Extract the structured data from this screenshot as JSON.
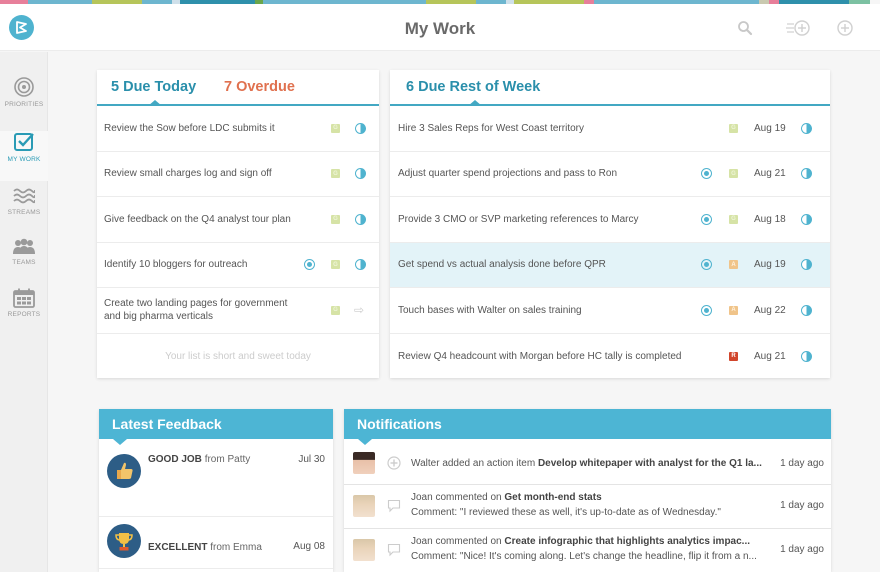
{
  "app": {
    "title": "My Work",
    "brand_color": "#4fb3cf",
    "stripe_colors": [
      "#e77f9a",
      "#6db6cf",
      "#b6c55a",
      "#6db6cf",
      "#cfe0ea",
      "#2e90ab",
      "#6aa64b",
      "#6db6cf",
      "#b6c55a",
      "#6db6cf",
      "#cfe0ea",
      "#b6c55a",
      "#e77f9a",
      "#6db6cf",
      "#c9c9b0",
      "#e77f9a",
      "#2e90ab",
      "#7cc1a2"
    ]
  },
  "header": {
    "title": "My Work",
    "icons": [
      "search-icon",
      "quick-add-icon",
      "add-icon"
    ]
  },
  "sidebar": {
    "items": [
      {
        "label": "PRIORITIES",
        "icon": "target-icon",
        "active": false
      },
      {
        "label": "MY WORK",
        "icon": "checkbox-icon",
        "active": true
      },
      {
        "label": "STREAMS",
        "icon": "waves-icon",
        "active": false
      },
      {
        "label": "TEAMS",
        "icon": "people-icon",
        "active": false
      },
      {
        "label": "REPORTS",
        "icon": "calendar-icon",
        "active": false
      }
    ]
  },
  "today_card": {
    "tabs": [
      {
        "label": "5 Due Today",
        "color": "#2a8fab",
        "active": true
      },
      {
        "label": "7 Overdue",
        "color": "#e0714f",
        "active": false
      }
    ],
    "tasks": [
      {
        "text": "Review the Sow before LDC submits it",
        "priority": false,
        "tag": "G",
        "status": "half-circle"
      },
      {
        "text": "Review small charges log and sign off",
        "priority": false,
        "tag": "G",
        "status": "half-circle"
      },
      {
        "text": "Give feedback on the Q4 analyst tour plan",
        "priority": false,
        "tag": "G",
        "status": "half-circle"
      },
      {
        "text": "Identify 10 bloggers for outreach",
        "priority": true,
        "tag": "G",
        "status": "half-circle"
      },
      {
        "text": "Create two landing pages for government and big pharma verticals",
        "priority": false,
        "tag": "G",
        "status": "arrow"
      }
    ],
    "empty_message": "Your list is short and sweet today"
  },
  "week_card": {
    "tabs": [
      {
        "label": "6 Due Rest of Week",
        "color": "#2a8fab",
        "active": true
      }
    ],
    "tasks": [
      {
        "text": "Hire 3 Sales Reps for West Coast territory",
        "priority": false,
        "tag": "G",
        "date": "Aug 19",
        "highlight": false
      },
      {
        "text": "Adjust quarter spend projections and pass to Ron",
        "priority": true,
        "tag": "G",
        "date": "Aug 21",
        "highlight": false
      },
      {
        "text": "Provide 3 CMO or SVP marketing references to Marcy",
        "priority": true,
        "tag": "G",
        "date": "Aug 18",
        "highlight": false
      },
      {
        "text": "Get spend vs actual analysis done before QPR",
        "priority": true,
        "tag": "A",
        "date": "Aug 19",
        "highlight": true
      },
      {
        "text": "Touch bases with Walter on sales training",
        "priority": true,
        "tag": "A",
        "date": "Aug 22",
        "highlight": false
      },
      {
        "text": "Review Q4 headcount with Morgan before HC tally is completed",
        "priority": false,
        "tag": "R",
        "date": "Aug 21",
        "highlight": false
      }
    ]
  },
  "feedback": {
    "title": "Latest Feedback",
    "items": [
      {
        "badge": "GOOD JOB",
        "from_word": "from",
        "from": "Patty",
        "date": "Jul 30",
        "icon": "thumbs-up-icon"
      },
      {
        "badge": "EXCELLENT",
        "from_word": "from",
        "from": "Emma",
        "date": "Aug 08",
        "icon": "trophy-icon"
      }
    ]
  },
  "notifications": {
    "title": "Notifications",
    "items": [
      {
        "actor": "Walter",
        "action": "added an action item",
        "subject": "Develop whitepaper with analyst for the Q1 la...",
        "comment": "",
        "time": "1 day ago",
        "icon": "add-circle-icon"
      },
      {
        "actor": "Joan",
        "action": "commented on",
        "subject": "Get month-end stats",
        "comment": "Comment: \"I reviewed these as well, it's up-to-date as of Wednesday.\"",
        "time": "1 day ago",
        "icon": "comment-icon"
      },
      {
        "actor": "Joan",
        "action": "commented on",
        "subject": "Create infographic that highlights analytics impac...",
        "comment": "Comment: \"Nice! It's coming along. Let's change the headline, flip it from a n...",
        "time": "1 day ago",
        "icon": "comment-icon"
      }
    ]
  }
}
